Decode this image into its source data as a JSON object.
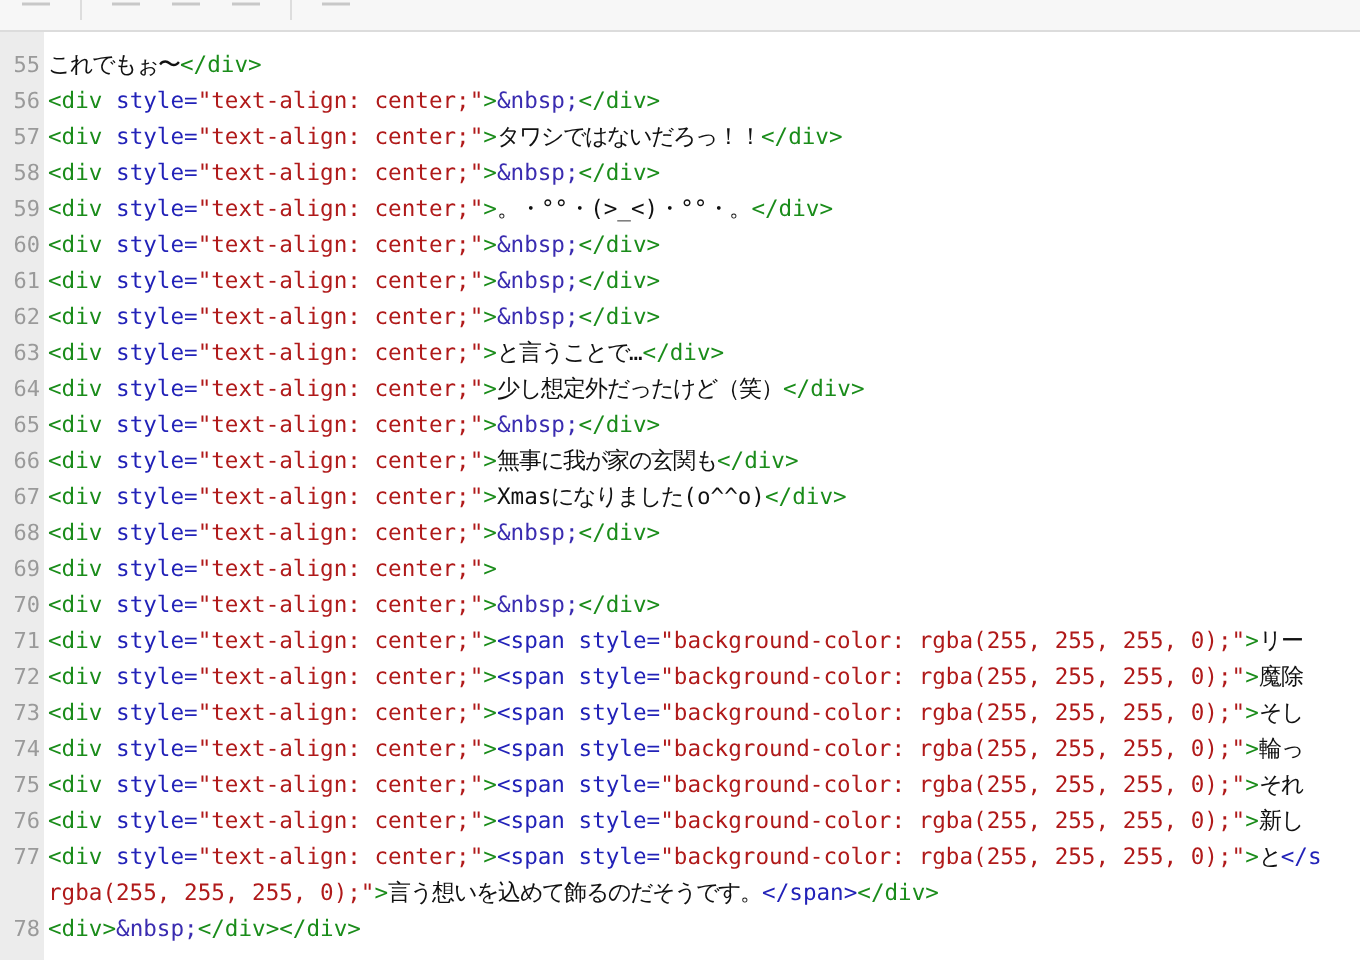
{
  "editor": {
    "lines": [
      {
        "number": "55",
        "tokens": [
          {
            "kind": "text",
            "text": "これでもぉ〜"
          },
          {
            "kind": "div-tag",
            "text": "</div>"
          }
        ]
      },
      {
        "number": "56",
        "tokens": [
          {
            "kind": "div-tag",
            "text": "<div "
          },
          {
            "kind": "attr",
            "text": "style="
          },
          {
            "kind": "value",
            "text": "\"text-align: center;\""
          },
          {
            "kind": "div-tag",
            "text": ">"
          },
          {
            "kind": "entity",
            "text": "&nbsp;"
          },
          {
            "kind": "div-tag",
            "text": "</div>"
          }
        ]
      },
      {
        "number": "57",
        "tokens": [
          {
            "kind": "div-tag",
            "text": "<div "
          },
          {
            "kind": "attr",
            "text": "style="
          },
          {
            "kind": "value",
            "text": "\"text-align: center;\""
          },
          {
            "kind": "div-tag",
            "text": ">"
          },
          {
            "kind": "text",
            "text": "タワシではないだろっ！！"
          },
          {
            "kind": "div-tag",
            "text": "</div>"
          }
        ]
      },
      {
        "number": "58",
        "tokens": [
          {
            "kind": "div-tag",
            "text": "<div "
          },
          {
            "kind": "attr",
            "text": "style="
          },
          {
            "kind": "value",
            "text": "\"text-align: center;\""
          },
          {
            "kind": "div-tag",
            "text": ">"
          },
          {
            "kind": "entity",
            "text": "&nbsp;"
          },
          {
            "kind": "div-tag",
            "text": "</div>"
          }
        ]
      },
      {
        "number": "59",
        "tokens": [
          {
            "kind": "div-tag",
            "text": "<div "
          },
          {
            "kind": "attr",
            "text": "style="
          },
          {
            "kind": "value",
            "text": "\"text-align: center;\""
          },
          {
            "kind": "div-tag",
            "text": ">"
          },
          {
            "kind": "text",
            "text": "。・°°・(>_<)・°°・。"
          },
          {
            "kind": "div-tag",
            "text": "</div>"
          }
        ]
      },
      {
        "number": "60",
        "tokens": [
          {
            "kind": "div-tag",
            "text": "<div "
          },
          {
            "kind": "attr",
            "text": "style="
          },
          {
            "kind": "value",
            "text": "\"text-align: center;\""
          },
          {
            "kind": "div-tag",
            "text": ">"
          },
          {
            "kind": "entity",
            "text": "&nbsp;"
          },
          {
            "kind": "div-tag",
            "text": "</div>"
          }
        ]
      },
      {
        "number": "61",
        "tokens": [
          {
            "kind": "div-tag",
            "text": "<div "
          },
          {
            "kind": "attr",
            "text": "style="
          },
          {
            "kind": "value",
            "text": "\"text-align: center;\""
          },
          {
            "kind": "div-tag",
            "text": ">"
          },
          {
            "kind": "entity",
            "text": "&nbsp;"
          },
          {
            "kind": "div-tag",
            "text": "</div>"
          }
        ]
      },
      {
        "number": "62",
        "tokens": [
          {
            "kind": "div-tag",
            "text": "<div "
          },
          {
            "kind": "attr",
            "text": "style="
          },
          {
            "kind": "value",
            "text": "\"text-align: center;\""
          },
          {
            "kind": "div-tag",
            "text": ">"
          },
          {
            "kind": "entity",
            "text": "&nbsp;"
          },
          {
            "kind": "div-tag",
            "text": "</div>"
          }
        ]
      },
      {
        "number": "63",
        "tokens": [
          {
            "kind": "div-tag",
            "text": "<div "
          },
          {
            "kind": "attr",
            "text": "style="
          },
          {
            "kind": "value",
            "text": "\"text-align: center;\""
          },
          {
            "kind": "div-tag",
            "text": ">"
          },
          {
            "kind": "text",
            "text": "と言うことで…"
          },
          {
            "kind": "div-tag",
            "text": "</div>"
          }
        ]
      },
      {
        "number": "64",
        "tokens": [
          {
            "kind": "div-tag",
            "text": "<div "
          },
          {
            "kind": "attr",
            "text": "style="
          },
          {
            "kind": "value",
            "text": "\"text-align: center;\""
          },
          {
            "kind": "div-tag",
            "text": ">"
          },
          {
            "kind": "text",
            "text": "少し想定外だったけど（笑）"
          },
          {
            "kind": "div-tag",
            "text": "</div>"
          }
        ]
      },
      {
        "number": "65",
        "tokens": [
          {
            "kind": "div-tag",
            "text": "<div "
          },
          {
            "kind": "attr",
            "text": "style="
          },
          {
            "kind": "value",
            "text": "\"text-align: center;\""
          },
          {
            "kind": "div-tag",
            "text": ">"
          },
          {
            "kind": "entity",
            "text": "&nbsp;"
          },
          {
            "kind": "div-tag",
            "text": "</div>"
          }
        ]
      },
      {
        "number": "66",
        "tokens": [
          {
            "kind": "div-tag",
            "text": "<div "
          },
          {
            "kind": "attr",
            "text": "style="
          },
          {
            "kind": "value",
            "text": "\"text-align: center;\""
          },
          {
            "kind": "div-tag",
            "text": ">"
          },
          {
            "kind": "text",
            "text": "無事に我が家の玄関も"
          },
          {
            "kind": "div-tag",
            "text": "</div>"
          }
        ]
      },
      {
        "number": "67",
        "tokens": [
          {
            "kind": "div-tag",
            "text": "<div "
          },
          {
            "kind": "attr",
            "text": "style="
          },
          {
            "kind": "value",
            "text": "\"text-align: center;\""
          },
          {
            "kind": "div-tag",
            "text": ">"
          },
          {
            "kind": "text",
            "text": "Xmasになりました(o^^o)"
          },
          {
            "kind": "div-tag",
            "text": "</div>"
          }
        ]
      },
      {
        "number": "68",
        "tokens": [
          {
            "kind": "div-tag",
            "text": "<div "
          },
          {
            "kind": "attr",
            "text": "style="
          },
          {
            "kind": "value",
            "text": "\"text-align: center;\""
          },
          {
            "kind": "div-tag",
            "text": ">"
          },
          {
            "kind": "entity",
            "text": "&nbsp;"
          },
          {
            "kind": "div-tag",
            "text": "</div>"
          }
        ]
      },
      {
        "number": "69",
        "tokens": [
          {
            "kind": "div-tag",
            "text": "<div "
          },
          {
            "kind": "attr",
            "text": "style="
          },
          {
            "kind": "value",
            "text": "\"text-align: center;\""
          },
          {
            "kind": "div-tag",
            "text": ">"
          }
        ]
      },
      {
        "number": "70",
        "tokens": [
          {
            "kind": "div-tag",
            "text": "<div "
          },
          {
            "kind": "attr",
            "text": "style="
          },
          {
            "kind": "value",
            "text": "\"text-align: center;\""
          },
          {
            "kind": "div-tag",
            "text": ">"
          },
          {
            "kind": "entity",
            "text": "&nbsp;"
          },
          {
            "kind": "div-tag",
            "text": "</div>"
          }
        ]
      },
      {
        "number": "71",
        "tokens": [
          {
            "kind": "div-tag",
            "text": "<div "
          },
          {
            "kind": "attr",
            "text": "style="
          },
          {
            "kind": "value",
            "text": "\"text-align: center;\""
          },
          {
            "kind": "div-tag",
            "text": ">"
          },
          {
            "kind": "span-tag",
            "text": "<span "
          },
          {
            "kind": "attr",
            "text": "style="
          },
          {
            "kind": "value",
            "text": "\"background-color: rgba(255, 255, 255, 0);\""
          },
          {
            "kind": "div-tag",
            "text": ">"
          },
          {
            "kind": "text",
            "text": "リー"
          }
        ]
      },
      {
        "number": "72",
        "tokens": [
          {
            "kind": "div-tag",
            "text": "<div "
          },
          {
            "kind": "attr",
            "text": "style="
          },
          {
            "kind": "value",
            "text": "\"text-align: center;\""
          },
          {
            "kind": "div-tag",
            "text": ">"
          },
          {
            "kind": "span-tag",
            "text": "<span "
          },
          {
            "kind": "attr",
            "text": "style="
          },
          {
            "kind": "value",
            "text": "\"background-color: rgba(255, 255, 255, 0);\""
          },
          {
            "kind": "div-tag",
            "text": ">"
          },
          {
            "kind": "text",
            "text": "魔除"
          }
        ]
      },
      {
        "number": "73",
        "tokens": [
          {
            "kind": "div-tag",
            "text": "<div "
          },
          {
            "kind": "attr",
            "text": "style="
          },
          {
            "kind": "value",
            "text": "\"text-align: center;\""
          },
          {
            "kind": "div-tag",
            "text": ">"
          },
          {
            "kind": "span-tag",
            "text": "<span "
          },
          {
            "kind": "attr",
            "text": "style="
          },
          {
            "kind": "value",
            "text": "\"background-color: rgba(255, 255, 255, 0);\""
          },
          {
            "kind": "div-tag",
            "text": ">"
          },
          {
            "kind": "text",
            "text": "そし"
          }
        ]
      },
      {
        "number": "74",
        "tokens": [
          {
            "kind": "div-tag",
            "text": "<div "
          },
          {
            "kind": "attr",
            "text": "style="
          },
          {
            "kind": "value",
            "text": "\"text-align: center;\""
          },
          {
            "kind": "div-tag",
            "text": ">"
          },
          {
            "kind": "span-tag",
            "text": "<span "
          },
          {
            "kind": "attr",
            "text": "style="
          },
          {
            "kind": "value",
            "text": "\"background-color: rgba(255, 255, 255, 0);\""
          },
          {
            "kind": "div-tag",
            "text": ">"
          },
          {
            "kind": "text",
            "text": "輪っ"
          }
        ]
      },
      {
        "number": "75",
        "tokens": [
          {
            "kind": "div-tag",
            "text": "<div "
          },
          {
            "kind": "attr",
            "text": "style="
          },
          {
            "kind": "value",
            "text": "\"text-align: center;\""
          },
          {
            "kind": "div-tag",
            "text": ">"
          },
          {
            "kind": "span-tag",
            "text": "<span "
          },
          {
            "kind": "attr",
            "text": "style="
          },
          {
            "kind": "value",
            "text": "\"background-color: rgba(255, 255, 255, 0);\""
          },
          {
            "kind": "div-tag",
            "text": ">"
          },
          {
            "kind": "text",
            "text": "それ"
          }
        ]
      },
      {
        "number": "76",
        "tokens": [
          {
            "kind": "div-tag",
            "text": "<div "
          },
          {
            "kind": "attr",
            "text": "style="
          },
          {
            "kind": "value",
            "text": "\"text-align: center;\""
          },
          {
            "kind": "div-tag",
            "text": ">"
          },
          {
            "kind": "span-tag",
            "text": "<span "
          },
          {
            "kind": "attr",
            "text": "style="
          },
          {
            "kind": "value",
            "text": "\"background-color: rgba(255, 255, 255, 0);\""
          },
          {
            "kind": "div-tag",
            "text": ">"
          },
          {
            "kind": "text",
            "text": "新し"
          }
        ]
      },
      {
        "number": "77",
        "tokens": [
          {
            "kind": "div-tag",
            "text": "<div "
          },
          {
            "kind": "attr",
            "text": "style="
          },
          {
            "kind": "value",
            "text": "\"text-align: center;\""
          },
          {
            "kind": "div-tag",
            "text": ">"
          },
          {
            "kind": "span-tag",
            "text": "<span "
          },
          {
            "kind": "attr",
            "text": "style="
          },
          {
            "kind": "value",
            "text": "\"background-color: rgba(255, 255, 255, 0);\""
          },
          {
            "kind": "div-tag",
            "text": ">"
          },
          {
            "kind": "text",
            "text": "と"
          },
          {
            "kind": "span-tag",
            "text": "</s"
          }
        ],
        "continuation": [
          {
            "kind": "value",
            "text": "rgba(255, 255, 255, 0);\""
          },
          {
            "kind": "div-tag",
            "text": ">"
          },
          {
            "kind": "text",
            "text": "言う想いを込めて飾るのだそうです。"
          },
          {
            "kind": "span-tag",
            "text": "</span>"
          },
          {
            "kind": "div-tag",
            "text": "</div>"
          }
        ]
      },
      {
        "number": "78",
        "tokens": [
          {
            "kind": "div-tag",
            "text": "<div>"
          },
          {
            "kind": "entity",
            "text": "&nbsp;"
          },
          {
            "kind": "div-tag",
            "text": "</div></div>"
          }
        ]
      }
    ]
  }
}
